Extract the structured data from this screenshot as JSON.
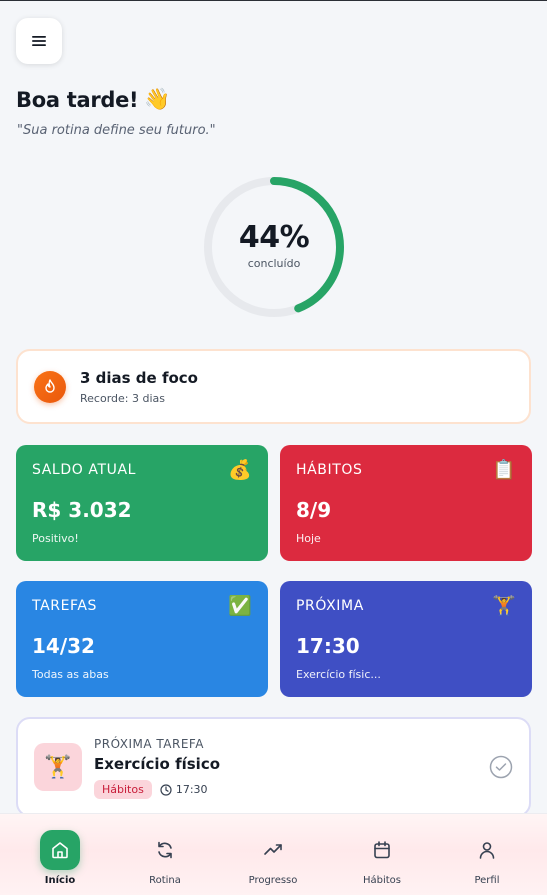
{
  "header": {
    "greeting": "Boa tarde!",
    "greeting_emoji": "👋",
    "quote": "\"Sua rotina define seu futuro.\""
  },
  "progress": {
    "percent_label": "44%",
    "percent_value": 0.44,
    "sub": "concluído",
    "color": "#27a466"
  },
  "streak": {
    "title": "3 dias de foco",
    "record": "Recorde: 3 dias"
  },
  "cards": [
    {
      "title": "SALDO ATUAL",
      "icon": "💰",
      "value": "R$ 3.032",
      "sub": "Positivo!"
    },
    {
      "title": "HÁBITOS",
      "icon": "📋",
      "value": "8/9",
      "sub": "Hoje"
    },
    {
      "title": "TAREFAS",
      "icon": "✅",
      "value": "14/32",
      "sub": "Todas as abas"
    },
    {
      "title": "PRÓXIMA",
      "icon": "🏋️",
      "value": "17:30",
      "sub": "Exercício físic..."
    }
  ],
  "next_task": {
    "label": "PRÓXIMA TAREFA",
    "icon": "🏋️",
    "title": "Exercício físico",
    "tag": "Hábitos",
    "time": "17:30"
  },
  "nav": [
    {
      "label": "Início",
      "icon": "home-icon",
      "active": true
    },
    {
      "label": "Rotina",
      "icon": "refresh-icon",
      "active": false
    },
    {
      "label": "Progresso",
      "icon": "trending-up-icon",
      "active": false
    },
    {
      "label": "Hábitos",
      "icon": "calendar-icon",
      "active": false
    },
    {
      "label": "Perfil",
      "icon": "user-icon",
      "active": false
    }
  ]
}
